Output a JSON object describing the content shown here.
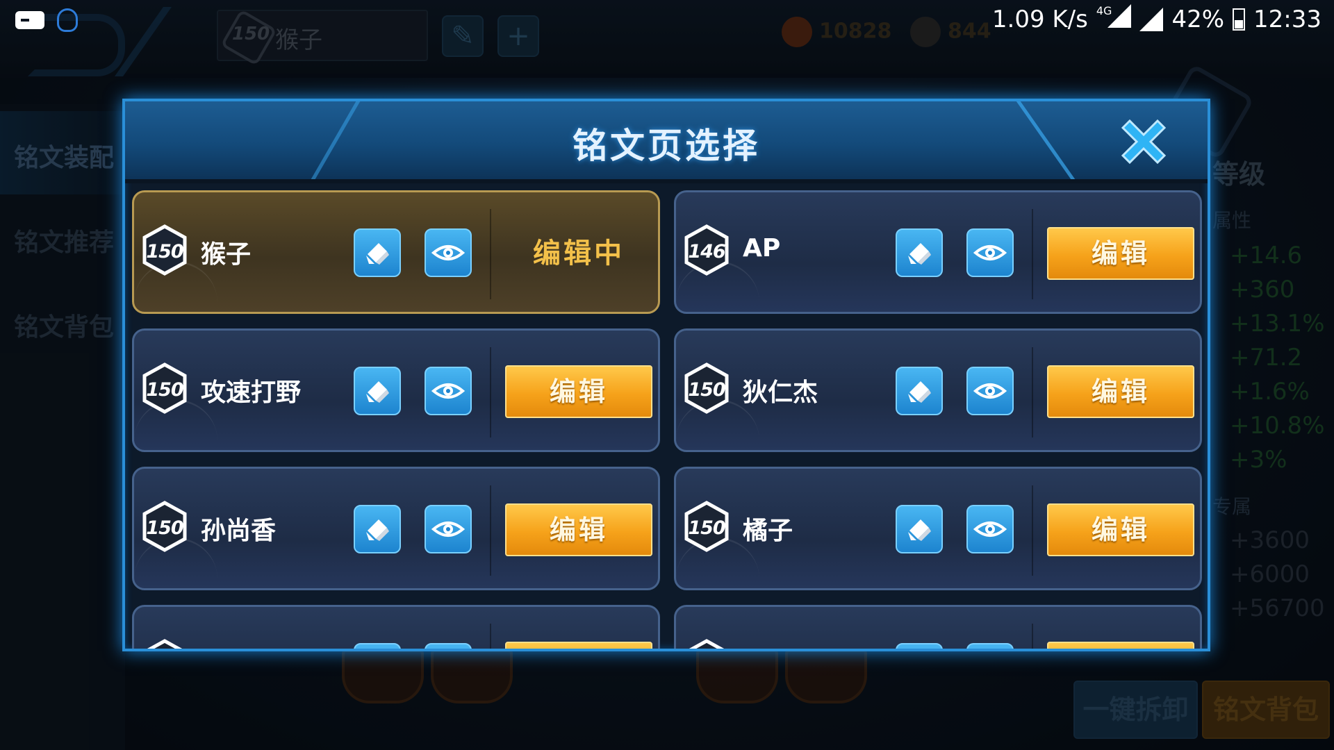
{
  "status_bar": {
    "speed": "1.09 K/s",
    "network": "4G",
    "battery": "42%",
    "time": "12:33"
  },
  "background": {
    "current_page_level": "150",
    "current_page_name": "猴子",
    "gold": "10828",
    "diamonds": "844",
    "sidebar": [
      "铭文装配",
      "铭文推荐",
      "铭文背包"
    ],
    "right_panel_title": "等级",
    "attr_label": "属性",
    "attr_stats": [
      "+14.6",
      "+360",
      "+13.1%",
      "+71.2",
      "+1.6%",
      "+10.8%",
      "+3%"
    ],
    "exclusive_label": "专属",
    "exclusive_stats": [
      "+3600",
      "+6000",
      "+56700"
    ],
    "bottom_buttons": [
      "一键拆卸",
      "铭文背包"
    ]
  },
  "dialog": {
    "title": "铭文页选择",
    "edit_label": "编辑",
    "editing_label": "编辑中",
    "pages": [
      {
        "level": "150",
        "name": "猴子",
        "active": true
      },
      {
        "level": "146",
        "name": "AP",
        "active": false
      },
      {
        "level": "150",
        "name": "攻速打野",
        "active": false
      },
      {
        "level": "150",
        "name": "狄仁杰",
        "active": false
      },
      {
        "level": "150",
        "name": "孙尚香",
        "active": false
      },
      {
        "level": "150",
        "name": "橘子",
        "active": false
      }
    ]
  },
  "colors": {
    "accent_blue": "#2a8fd8",
    "edit_orange": "#f6a21a",
    "editing_gold": "#f3c04a",
    "active_card": "#5a4a28"
  },
  "icons": [
    "close-icon",
    "pencil-icon",
    "eye-icon",
    "hex-level-badge"
  ]
}
